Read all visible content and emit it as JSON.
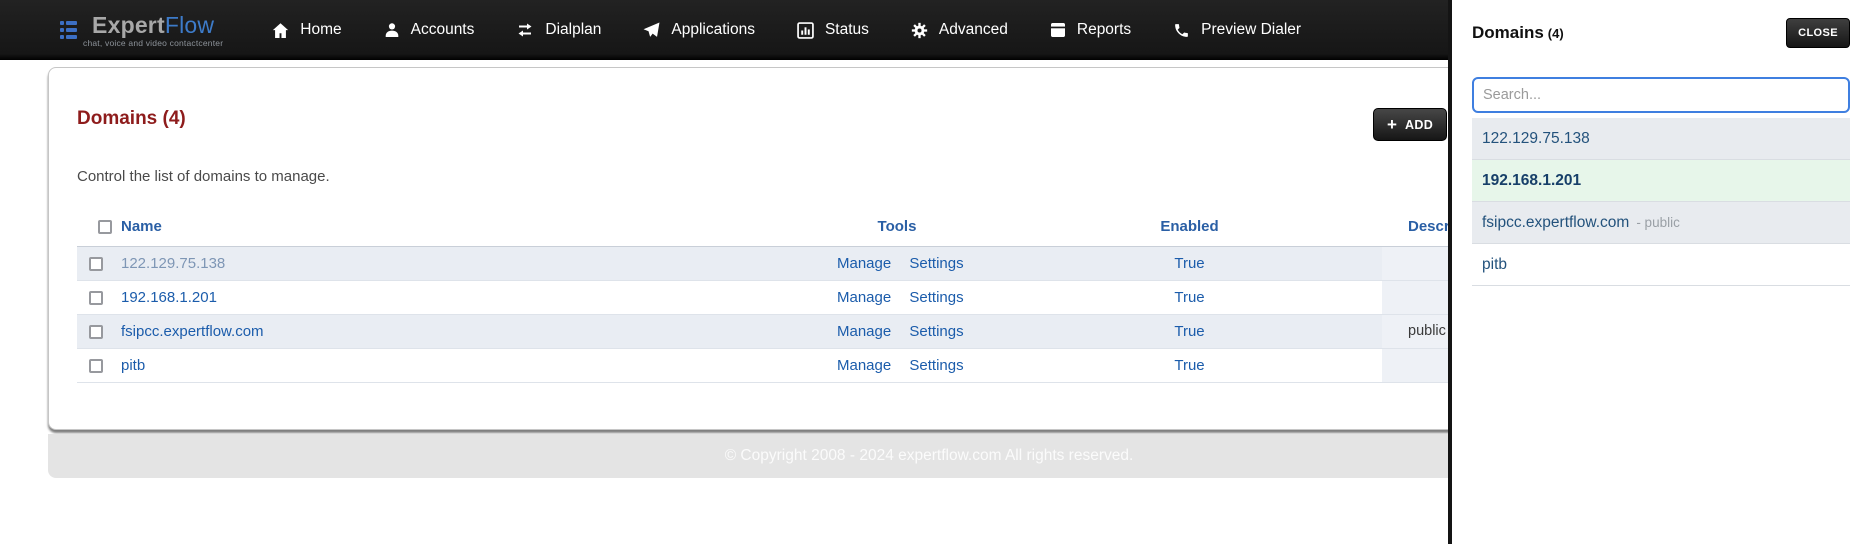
{
  "brand": {
    "name_primary": "Expert",
    "name_secondary": "Flow",
    "tagline": "chat, voice and video contactcenter"
  },
  "nav": {
    "items": [
      {
        "label": "Home",
        "icon": "home-icon"
      },
      {
        "label": "Accounts",
        "icon": "person-icon"
      },
      {
        "label": "Dialplan",
        "icon": "swap-arrows-icon"
      },
      {
        "label": "Applications",
        "icon": "paper-plane-icon"
      },
      {
        "label": "Status",
        "icon": "bar-chart-icon"
      },
      {
        "label": "Advanced",
        "icon": "gear-icon"
      },
      {
        "label": "Reports",
        "icon": "journal-icon"
      },
      {
        "label": "Preview Dialer",
        "icon": "phone-icon"
      }
    ]
  },
  "main": {
    "title": "Domains (4)",
    "subtitle": "Control the list of domains to manage.",
    "add_button": {
      "plus": "+",
      "label": "ADD"
    },
    "table": {
      "headers": {
        "name": "Name",
        "tools": "Tools",
        "enabled": "Enabled",
        "description": "Description"
      },
      "rows": [
        {
          "name": "122.129.75.138",
          "tools": [
            "Manage",
            "Settings"
          ],
          "enabled": "True",
          "description": "",
          "visited": true
        },
        {
          "name": "192.168.1.201",
          "tools": [
            "Manage",
            "Settings"
          ],
          "enabled": "True",
          "description": "",
          "visited": false
        },
        {
          "name": "fsipcc.expertflow.com",
          "tools": [
            "Manage",
            "Settings"
          ],
          "enabled": "True",
          "description": "public",
          "visited": false
        },
        {
          "name": "pitb",
          "tools": [
            "Manage",
            "Settings"
          ],
          "enabled": "True",
          "description": "",
          "visited": false
        }
      ]
    },
    "footer_text": "© Copyright 2008 - 2024 expertflow.com All rights reserved."
  },
  "panel": {
    "title": "Domains",
    "count": "(4)",
    "close_button": "CLOSE",
    "search": {
      "placeholder": "Search...",
      "value": ""
    },
    "items": [
      {
        "label": "122.129.75.138",
        "suffix": "",
        "selected": false
      },
      {
        "label": "192.168.1.201",
        "suffix": "",
        "selected": true
      },
      {
        "label": "fsipcc.expertflow.com",
        "suffix": "- public",
        "selected": false
      },
      {
        "label": "pitb",
        "suffix": "",
        "selected": false
      }
    ]
  },
  "colors": {
    "accent_red": "#8e1c1c",
    "link_blue": "#1b5cab",
    "header_blue": "#2a5fa5",
    "visited_link": "#7e96b5",
    "navbar_bg": "#1a1a1a",
    "brand_blue": "#3c6fc4",
    "stripe_bg": "#e9edf3",
    "selected_green": "#e7f6ea",
    "search_border": "#3f7fe0",
    "footer_bg": "#e4e4e4"
  }
}
